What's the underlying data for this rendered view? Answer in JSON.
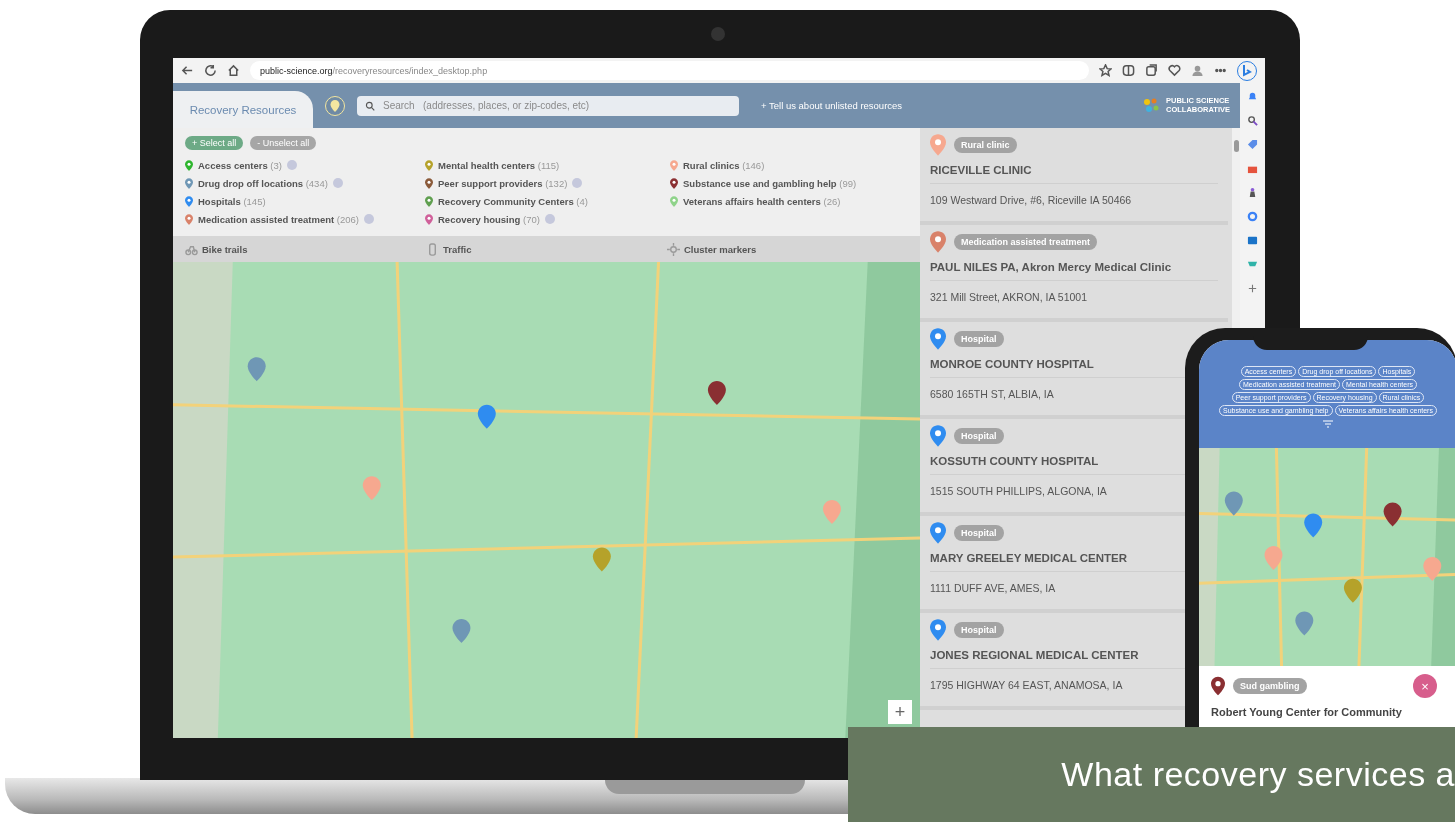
{
  "browser": {
    "url_domain": "public-science.org",
    "url_path": "/recoveryresources/index_desktop.php"
  },
  "header": {
    "tab": "Recovery Resources",
    "search_placeholder": "Search   (addresses, places, or zip-codes, etc)",
    "link": "+ Tell us about unlisted resources",
    "logo_line1": "PUBLIC SCIENCE",
    "logo_line2": "COLLABORATIVE"
  },
  "filters": {
    "select_all": "+ Select all",
    "unselect_all": "- Unselect all",
    "categories": [
      {
        "name": "Access centers",
        "count": "(3)",
        "info": true,
        "color": "#2db52d"
      },
      {
        "name": "Drug drop off locations",
        "count": "(434)",
        "info": true,
        "color": "#6f97b5"
      },
      {
        "name": "Hospitals",
        "count": "(145)",
        "info": false,
        "color": "#2f8cf0"
      },
      {
        "name": "Medication assisted treatment",
        "count": "(206)",
        "info": true,
        "color": "#d9826a"
      },
      {
        "name": "Mental health centers",
        "count": "(115)",
        "info": false,
        "color": "#b5a22a"
      },
      {
        "name": "Peer support providers",
        "count": "(132)",
        "info": true,
        "color": "#8a5a3a"
      },
      {
        "name": "Recovery Community Centers",
        "count": "(4)",
        "info": false,
        "color": "#5f9f4f"
      },
      {
        "name": "Recovery housing",
        "count": "(70)",
        "info": true,
        "color": "#d0609a"
      },
      {
        "name": "Rural clinics",
        "count": "(146)",
        "info": false,
        "color": "#f6a88f"
      },
      {
        "name": "Substance use and gambling help",
        "count": "(99)",
        "info": false,
        "color": "#8a2f32"
      },
      {
        "name": "Veterans affairs health centers",
        "count": "(26)",
        "info": false,
        "color": "#8fd38a"
      }
    ]
  },
  "map_options": [
    {
      "kind": "bike",
      "label": "Bike trails"
    },
    {
      "kind": "traffic",
      "label": "Traffic"
    },
    {
      "kind": "cluster",
      "label": "Cluster markers"
    }
  ],
  "map": {
    "kind": "picture",
    "zoom_button": "+"
  },
  "results": [
    {
      "category": "Rural clinic",
      "color": "#f6a88f",
      "name": "RICEVILLE CLINIC",
      "address": "109 Westward Drive, #6, Riceville IA 50466"
    },
    {
      "category": "Medication assisted treatment",
      "color": "#d9826a",
      "name": "PAUL NILES PA, Akron Mercy Medical Clinic",
      "address": "321 Mill Street, AKRON, IA 51001"
    },
    {
      "category": "Hospital",
      "color": "#2f8cf0",
      "name": "MONROE COUNTY HOSPITAL",
      "address": "6580 165TH ST, ALBIA, IA"
    },
    {
      "category": "Hospital",
      "color": "#2f8cf0",
      "name": "KOSSUTH COUNTY HOSPITAL",
      "address": "1515 SOUTH PHILLIPS, ALGONA, IA"
    },
    {
      "category": "Hospital",
      "color": "#2f8cf0",
      "name": "MARY GREELEY MEDICAL CENTER",
      "address": "1111 DUFF AVE, AMES, IA"
    },
    {
      "category": "Hospital",
      "color": "#2f8cf0",
      "name": "JONES REGIONAL MEDICAL CENTER",
      "address": "1795 HIGHWAY 64 EAST, ANAMOSA, IA"
    }
  ],
  "phone": {
    "chips": [
      "Access centers",
      "Drug drop off locations",
      "Hospitals",
      "Medication assisted treatment",
      "Mental health centers",
      "Peer support providers",
      "Recovery housing",
      "Rural clinics",
      "Substance use and gambling help",
      "Veterans affairs health centers"
    ],
    "map": {
      "kind": "picture"
    },
    "card": {
      "badge": "Sud gambling",
      "color": "#8a2f32",
      "title": "Robert Young Center for Community",
      "close": "×"
    }
  },
  "banner": {
    "text": "What recovery services a"
  }
}
